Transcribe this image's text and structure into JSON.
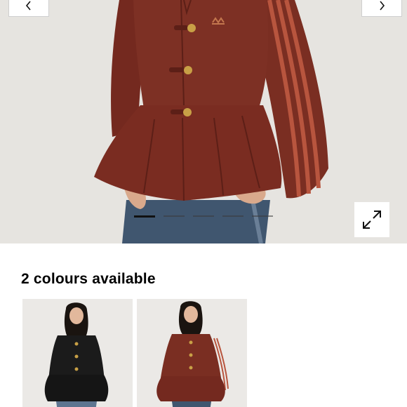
{
  "gallery": {
    "prev_icon": "chevron-left-icon",
    "next_icon": "chevron-right-icon",
    "expand_icon": "expand-icon",
    "slides_count": 5,
    "active_slide": 1,
    "colors": {
      "background": "#e6e4e0",
      "jacket": "#7a2e22",
      "stripe": "#b8553e",
      "button": "#c8a046",
      "denim": "#3e556e"
    }
  },
  "colours": {
    "title": "2 colours available",
    "options": [
      {
        "name": "black",
        "color": "#1b1b1b",
        "selected": false
      },
      {
        "name": "burgundy",
        "color": "#7a2e22",
        "selected": true
      }
    ]
  }
}
